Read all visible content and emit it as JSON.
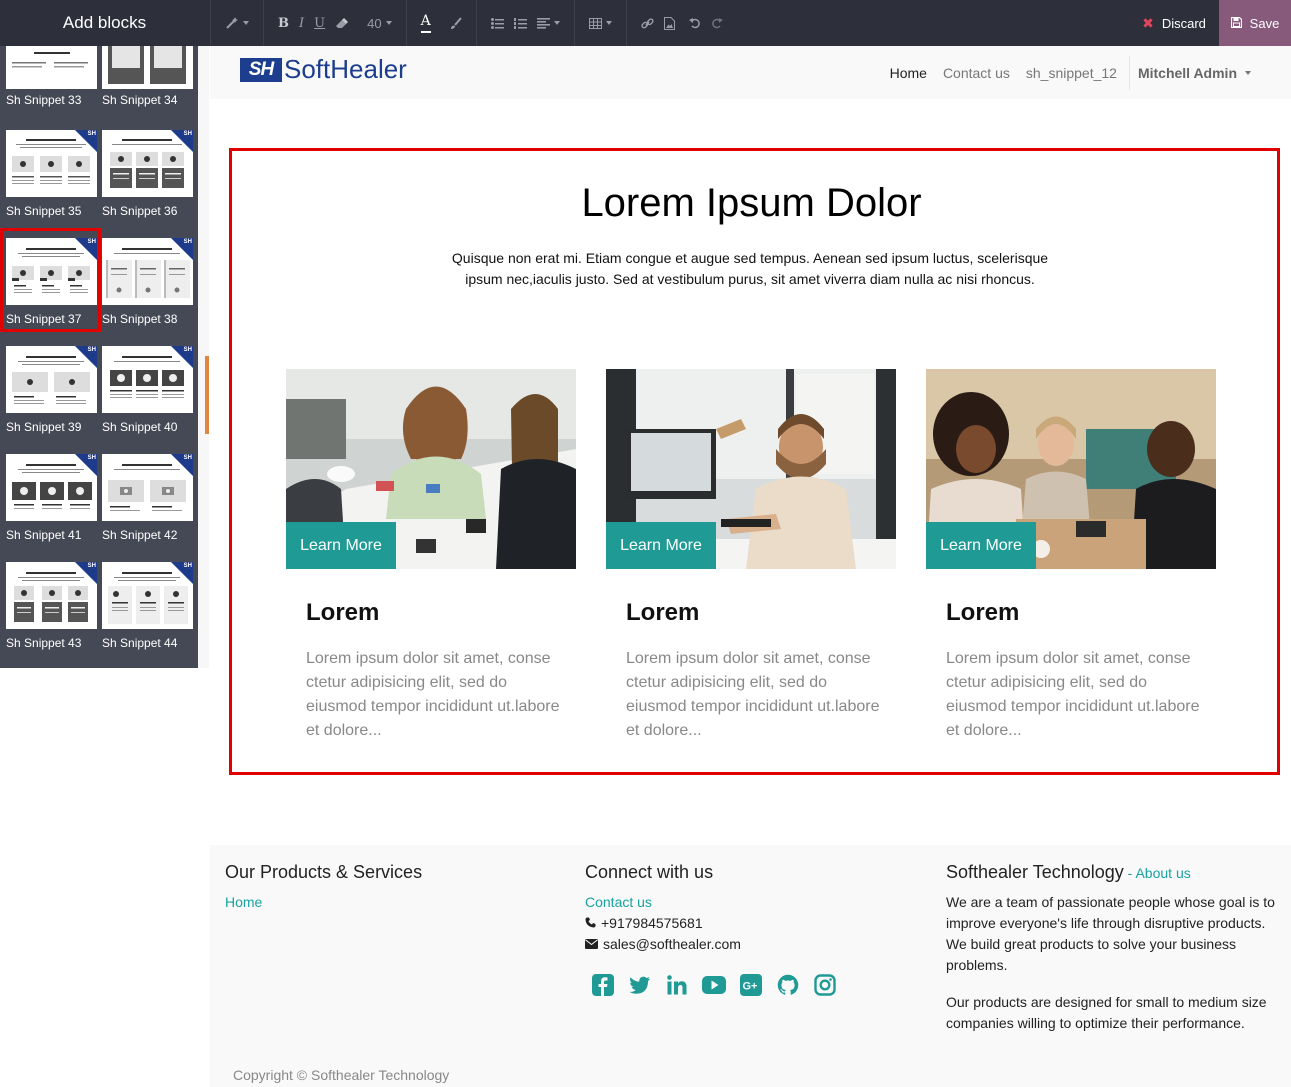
{
  "editor": {
    "panel_title": "Add blocks",
    "font_size": "40",
    "discard_label": "Discard",
    "save_label": "Save"
  },
  "snippets": [
    {
      "label": "Sh Snippet 33"
    },
    {
      "label": "Sh Snippet 34"
    },
    {
      "label": "Sh Snippet 35"
    },
    {
      "label": "Sh Snippet 36"
    },
    {
      "label": "Sh Snippet 37",
      "selected": true
    },
    {
      "label": "Sh Snippet 38"
    },
    {
      "label": "Sh Snippet 39"
    },
    {
      "label": "Sh Snippet 40"
    },
    {
      "label": "Sh Snippet 41"
    },
    {
      "label": "Sh Snippet 42"
    },
    {
      "label": "Sh Snippet 43"
    },
    {
      "label": "Sh Snippet 44"
    }
  ],
  "header": {
    "logo_mark": "SH",
    "logo_text": "SoftHealer",
    "nav": [
      "Home",
      "Contact us",
      "sh_snippet_12"
    ],
    "active_nav": "Home",
    "user": "Mitchell Admin"
  },
  "section": {
    "title": "Lorem Ipsum Dolor",
    "subtitle": "Quisque non erat mi. Etiam congue et augue sed tempus. Aenean sed ipsum luctus, scelerisque ipsum nec,iaculis justo. Sed at vestibulum purus, sit amet viverra diam nulla ac nisi rhoncus.",
    "cards": [
      {
        "button": "Learn More",
        "title": "Lorem",
        "text": "Lorem ipsum dolor sit amet, conse ctetur adipisicing elit, sed do eiusmod tempor incididunt ut.labore et dolore..."
      },
      {
        "button": "Learn More",
        "title": "Lorem",
        "text": "Lorem ipsum dolor sit amet, conse ctetur adipisicing elit, sed do eiusmod tempor incididunt ut.labore et dolore..."
      },
      {
        "button": "Learn More",
        "title": "Lorem",
        "text": "Lorem ipsum dolor sit amet, conse ctetur adipisicing elit, sed do eiusmod tempor incididunt ut.labore et dolore..."
      }
    ]
  },
  "footer": {
    "col1": {
      "title": "Our Products & Services",
      "link": "Home"
    },
    "col2": {
      "title": "Connect with us",
      "link": "Contact us",
      "phone": "+917984575681",
      "email": "sales@softhealer.com",
      "social_icons": [
        "facebook-icon",
        "twitter-icon",
        "linkedin-icon",
        "youtube-icon",
        "google-plus-icon",
        "github-icon",
        "instagram-icon"
      ]
    },
    "col3": {
      "title": "Softhealer Technology",
      "separator": " - ",
      "link": "About us",
      "p1": "We are a team of passionate people whose goal is to improve everyone's life through disruptive products. We build great products to solve your business problems.",
      "p2": "Our products are designed for small to medium size companies willing to optimize their performance."
    },
    "copyright": "Copyright © Softhealer Technology"
  },
  "colors": {
    "accent": "#1f9a95",
    "link": "#17a2a0",
    "editor_bar": "#2d2f3a",
    "save": "#875a7b",
    "selection": "#e00000",
    "brand": "#1d3e8f"
  }
}
